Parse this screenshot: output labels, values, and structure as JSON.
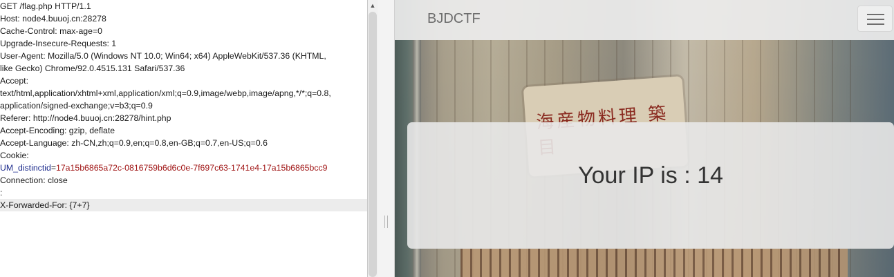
{
  "request": {
    "lines": [
      "GET /flag.php HTTP/1.1",
      "Host: node4.buuoj.cn:28278",
      "Cache-Control: max-age=0",
      "Upgrade-Insecure-Requests: 1",
      "User-Agent: Mozilla/5.0 (Windows NT 10.0; Win64; x64) AppleWebKit/537.36 (KHTML,",
      "like Gecko) Chrome/92.0.4515.131 Safari/537.36",
      "Accept:",
      "text/html,application/xhtml+xml,application/xml;q=0.9,image/webp,image/apng,*/*;q=0.8,",
      "application/signed-exchange;v=b3;q=0.9",
      "Referer: http://node4.buuoj.cn:28278/hint.php",
      "Accept-Encoding: gzip, deflate",
      "Accept-Language: zh-CN,zh;q=0.9,en;q=0.8,en-GB;q=0.7,en-US;q=0.6",
      "Cookie:"
    ],
    "cookie": {
      "name": "UM_distinctid",
      "eq": "=",
      "value": "17a15b6865a72c-0816759b6d6c0e-7f697c63-1741e4-17a15b6865bcc9"
    },
    "after_lines": [
      "Connection: close",
      ""
    ],
    "active_line": "X-Forwarded-For: {7+7}"
  },
  "scrollbar": {
    "up_arrow": "▲",
    "icon": "up-arrow-icon"
  },
  "page": {
    "brand": "BJDCTF",
    "sign_text": "海産物料理 築目",
    "toggler_icon": "hamburger-menu-icon",
    "ip_message": "Your IP is : 14"
  },
  "colors": {
    "cookie_name": "#1b2a8c",
    "cookie_value": "#a01515",
    "active_line_bg": "#ececec"
  }
}
